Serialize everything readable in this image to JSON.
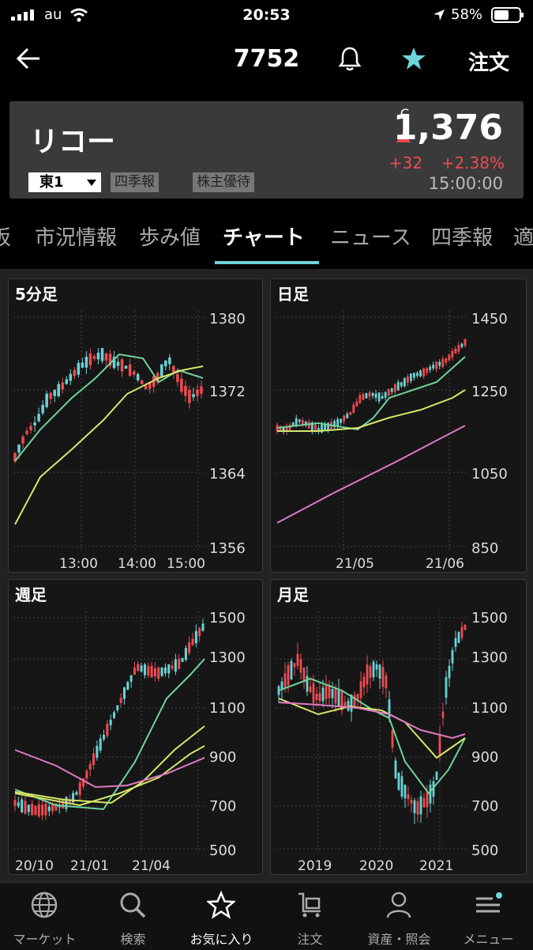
{
  "status_bar": {
    "carrier": "au",
    "time": "20:53",
    "battery": "58%"
  },
  "nav": {
    "title": "7752",
    "order_label": "注文"
  },
  "quote": {
    "name": "リコー",
    "price_marker": "C",
    "price": "1,376",
    "change": "+32",
    "change_pct": "+2.38%",
    "time": "15:00:00",
    "market": "東1",
    "badges": [
      "四季報",
      "株主優待"
    ],
    "up_color": "#ef4b50"
  },
  "tabs": [
    "板",
    "市況情報",
    "歩み値",
    "チャート",
    "ニュース",
    "四季報",
    "適"
  ],
  "active_tab": "チャート",
  "charts": [
    {
      "title": "5分足",
      "y_ticks": [
        "1380",
        "1372",
        "1364",
        "1356"
      ],
      "x_ticks": [
        "13:00",
        "14:00",
        "15:00"
      ]
    },
    {
      "title": "日足",
      "y_ticks": [
        "1450",
        "1250",
        "1050",
        "850"
      ],
      "x_ticks": [
        "21/05",
        "21/06"
      ]
    },
    {
      "title": "週足",
      "y_ticks": [
        "1500",
        "1300",
        "1100",
        "900",
        "700",
        "500"
      ],
      "x_ticks": [
        "20/10",
        "21/01",
        "21/04"
      ]
    },
    {
      "title": "月足",
      "y_ticks": [
        "1500",
        "1300",
        "1100",
        "900",
        "700",
        "500"
      ],
      "x_ticks": [
        "2019",
        "2020",
        "2021"
      ]
    }
  ],
  "bottom_tabs": [
    {
      "label": "マーケット",
      "icon": "globe-icon"
    },
    {
      "label": "検索",
      "icon": "search-icon"
    },
    {
      "label": "お気に入り",
      "icon": "star-icon"
    },
    {
      "label": "注文",
      "icon": "cart-icon"
    },
    {
      "label": "資産・照会",
      "icon": "person-icon"
    },
    {
      "label": "メニュー",
      "icon": "menu-icon"
    }
  ],
  "colors": {
    "up": "#ef4b50",
    "down": "#6ad3d6",
    "ma_short": "#6fd39b",
    "ma_mid": "#d5e76a",
    "ma_long": "#e07ac0",
    "accent": "#6dd4d8"
  }
}
